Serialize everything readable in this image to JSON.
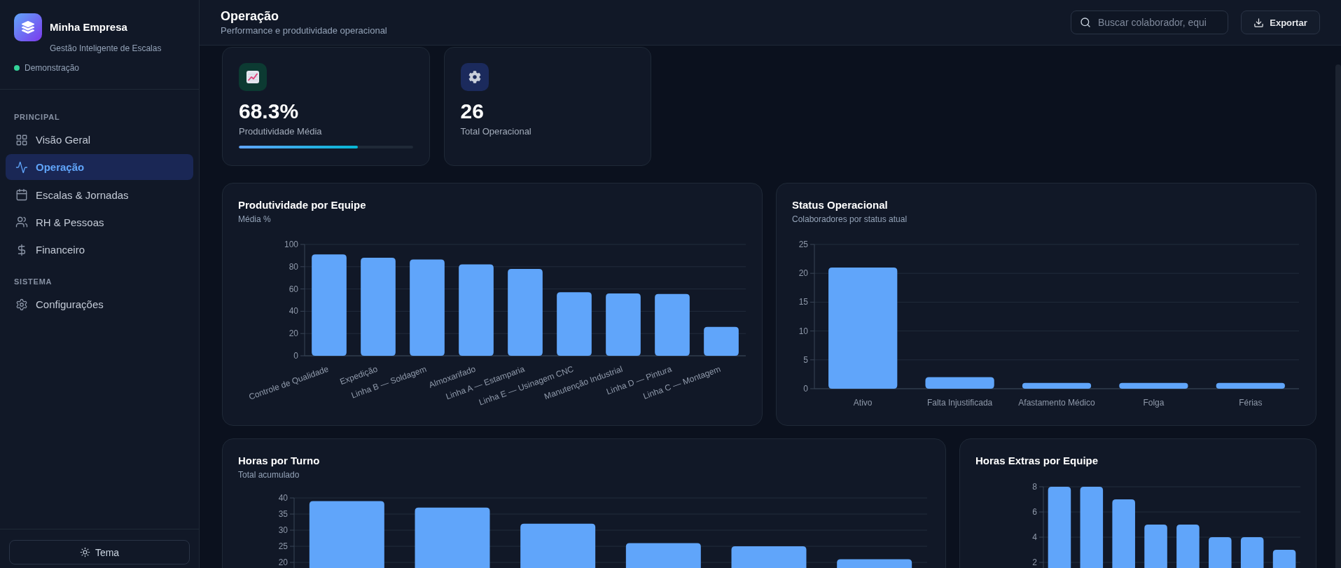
{
  "sidebar": {
    "brand": {
      "name": "Minha Empresa",
      "tagline": "Gestão Inteligente de Escalas"
    },
    "mode": "Demonstração",
    "sections": [
      {
        "title": "PRINCIPAL",
        "items": [
          {
            "label": "Visão Geral",
            "selected": false
          },
          {
            "label": "Operação",
            "selected": true
          },
          {
            "label": "Escalas & Jornadas",
            "selected": false
          },
          {
            "label": "RH & Pessoas",
            "selected": false
          },
          {
            "label": "Financeiro",
            "selected": false
          }
        ]
      },
      {
        "title": "SISTEMA",
        "items": [
          {
            "label": "Configurações",
            "selected": false
          }
        ]
      }
    ],
    "theme_button": "Tema"
  },
  "header": {
    "title": "Operação",
    "subtitle": "Performance e produtividade operacional",
    "search": {
      "placeholder": "Buscar colaborador, equi"
    },
    "export_button": "Exportar"
  },
  "kpis": [
    {
      "kind": "progress",
      "value": "68.3%",
      "label": "Produtividade Média",
      "level": 0.683
    },
    {
      "kind": "count",
      "value": "26",
      "label": "Total Operacional"
    }
  ],
  "charts": [
    {
      "title": "Produtividade por Equipe",
      "subtitle": "Média %",
      "chart_data": {
        "type": "bar",
        "categories": [
          "Controle de Qualidade",
          "Expedição",
          "Linha B — Soldagem",
          "Almoxarifado",
          "Linha A — Estamparia",
          "Linha E — Usinagem CNC",
          "Manutenção Industrial",
          "Linha D — Pintura",
          "Linha C — Montagem"
        ],
        "values": [
          91,
          88,
          86.5,
          82,
          78,
          57,
          56,
          55.5,
          26
        ],
        "ylim": [
          0,
          100
        ],
        "yticks": [
          0,
          20,
          40,
          60,
          80,
          100
        ],
        "grid": true
      }
    },
    {
      "title": "Status Operacional",
      "subtitle": "Colaboradores por status atual",
      "chart_data": {
        "type": "bar",
        "categories": [
          "Ativo",
          "Falta Injustificada",
          "Afastamento Médico",
          "Folga",
          "Férias"
        ],
        "values": [
          21,
          2,
          1,
          1,
          1
        ],
        "ylim": [
          0,
          25
        ],
        "yticks": [
          0,
          5,
          10,
          15,
          20,
          25
        ],
        "grid": true
      }
    },
    {
      "title": "Horas por Turno",
      "subtitle": "Total acumulado",
      "chart_data": {
        "type": "bar",
        "values": [
          39,
          37,
          32,
          26,
          25,
          21
        ],
        "ylim": [
          0,
          40
        ],
        "yticks": [
          20,
          25,
          30,
          35,
          40
        ],
        "grid": true
      }
    },
    {
      "title": "Horas Extras por Equipe",
      "chart_data": {
        "type": "bar",
        "values": [
          8,
          8,
          7,
          5,
          5,
          4,
          4,
          3
        ],
        "ylim": [
          0,
          8
        ],
        "yticks": [
          2,
          4,
          6,
          8
        ],
        "grid": true
      }
    }
  ]
}
